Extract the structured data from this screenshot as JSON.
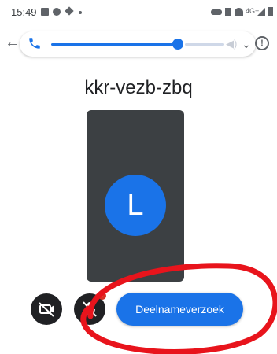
{
  "status_bar": {
    "time": "15:49",
    "right_badge": "4G+"
  },
  "volume_bar": {
    "level_fraction": 0.74,
    "accent": "#1a73e8"
  },
  "meeting": {
    "code": "kkr-vezb-zbq",
    "avatar_letter": "L"
  },
  "controls": {
    "join_label": "Deelnameverzoek",
    "mic_badge": "!"
  },
  "colors": {
    "accent": "#1a73e8",
    "tile": "#3c4043",
    "annotation": "#e8141c"
  }
}
